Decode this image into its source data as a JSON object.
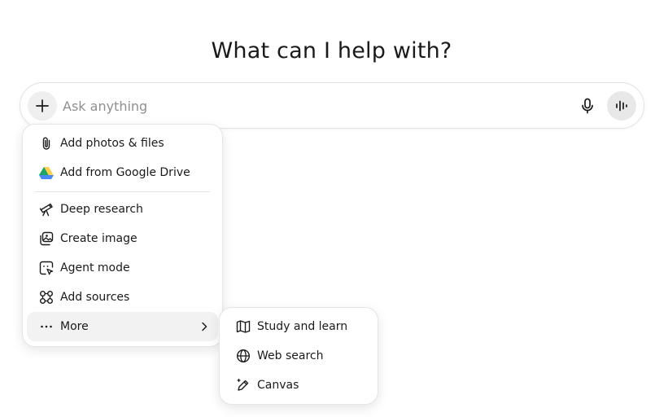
{
  "header": {
    "title": "What can I help with?"
  },
  "composer": {
    "placeholder": "Ask anything",
    "value": "",
    "plus_icon": "plus-icon",
    "mic_icon": "microphone-icon",
    "voice_icon": "voice-mode-icon"
  },
  "attach_menu": {
    "items": [
      {
        "label": "Add photos & files",
        "icon": "paperclip-icon"
      },
      {
        "label": "Add from Google Drive",
        "icon": "google-drive-icon"
      },
      {
        "label": "Deep research",
        "icon": "telescope-icon"
      },
      {
        "label": "Create image",
        "icon": "image-icon"
      },
      {
        "label": "Agent mode",
        "icon": "agent-cursor-icon"
      },
      {
        "label": "Add sources",
        "icon": "sources-icon"
      },
      {
        "label": "More",
        "icon": "ellipsis-icon",
        "submenu_icon": "chevron-right-icon"
      }
    ]
  },
  "more_menu": {
    "items": [
      {
        "label": "Study and learn",
        "icon": "book-icon"
      },
      {
        "label": "Web search",
        "icon": "globe-icon"
      },
      {
        "label": "Canvas",
        "icon": "canvas-pen-icon"
      }
    ]
  },
  "colors": {
    "text": "#1a1a1a",
    "placeholder": "#8f8f8f",
    "hover": "#f2f2f2",
    "border": "#e5e5e5",
    "drive_green": "#1fa463",
    "drive_yellow": "#ffd04b",
    "drive_blue": "#4688f4"
  }
}
